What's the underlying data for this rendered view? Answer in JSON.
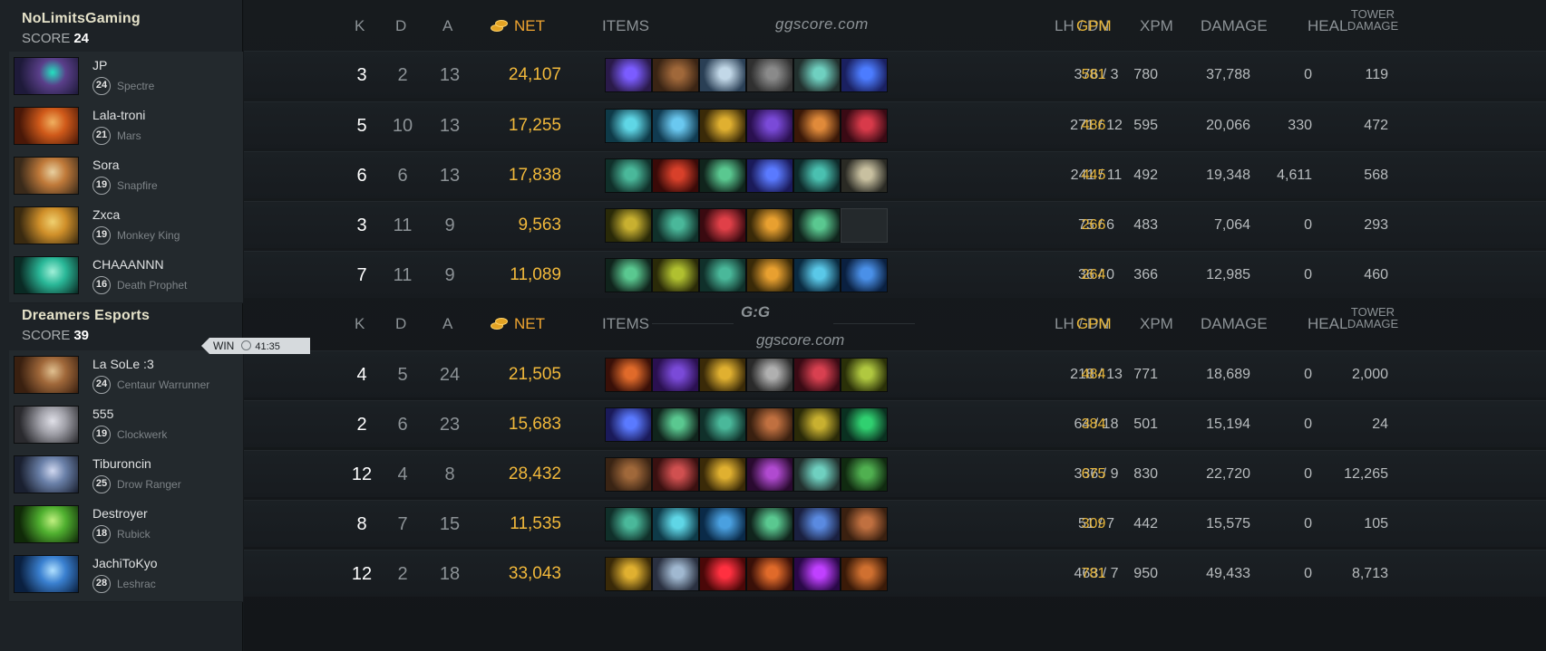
{
  "teams": [
    {
      "name": "NoLimitsGaming",
      "score_label": "SCORE",
      "score": "24",
      "players": [
        {
          "name": "JP",
          "level": "24",
          "hero": "Spectre",
          "portrait": [
            "#1e1a3a",
            "#5a3f8a",
            "#24e0c0"
          ],
          "k": "3",
          "d": "2",
          "a": "13",
          "net": "24,107",
          "lh": "376",
          "dn": "3",
          "gpm": "581",
          "xpm": "780",
          "damage": "37,788",
          "heal": "0",
          "tower": "119",
          "items": [
            [
              "#2a1a4a",
              "#7b5cff"
            ],
            [
              "#3a2414",
              "#a0683a"
            ],
            [
              "#2a3f55",
              "#c2d8e8"
            ],
            [
              "#303030",
              "#8a8a8a"
            ],
            [
              "#22302e",
              "#6fd0c0"
            ],
            [
              "#1a2060",
              "#4c7cff"
            ]
          ]
        },
        {
          "name": "Lala-troni",
          "level": "21",
          "hero": "Mars",
          "portrait": [
            "#4a1808",
            "#d05a1a",
            "#f0b060"
          ],
          "k": "5",
          "d": "10",
          "a": "13",
          "net": "17,255",
          "lh": "271",
          "dn": "12",
          "gpm": "486",
          "xpm": "595",
          "damage": "20,066",
          "heal": "330",
          "tower": "472",
          "items": [
            [
              "#0e3a48",
              "#5fd6e6"
            ],
            [
              "#103a50",
              "#6ac8f0"
            ],
            [
              "#3a2a08",
              "#e0b030"
            ],
            [
              "#2a1050",
              "#7a4ad8"
            ],
            [
              "#3a1808",
              "#e08a3a"
            ],
            [
              "#3a0a14",
              "#d83a4a"
            ]
          ]
        },
        {
          "name": "Sora",
          "level": "19",
          "hero": "Snapfire",
          "portrait": [
            "#3a2a1a",
            "#c07a3a",
            "#e8d0a0"
          ],
          "k": "6",
          "d": "6",
          "a": "13",
          "net": "17,838",
          "lh": "241",
          "dn": "11",
          "gpm": "445",
          "xpm": "492",
          "damage": "19,348",
          "heal": "4,611",
          "tower": "568",
          "items": [
            [
              "#10302a",
              "#4ab89a"
            ],
            [
              "#3a0a08",
              "#d8402a"
            ],
            [
              "#10241c",
              "#5ac890"
            ],
            [
              "#1a1a5a",
              "#5a7aff"
            ],
            [
              "#0e2a2a",
              "#4ac0b0"
            ],
            [
              "#2a2a24",
              "#c8c0a0"
            ]
          ]
        },
        {
          "name": "Zxca",
          "level": "19",
          "hero": "Monkey King",
          "portrait": [
            "#3a2a10",
            "#d0902a",
            "#f0d070"
          ],
          "k": "3",
          "d": "11",
          "a": "9",
          "net": "9,563",
          "lh": "75",
          "dn": "6",
          "gpm": "266",
          "xpm": "483",
          "damage": "7,064",
          "heal": "0",
          "tower": "293",
          "items": [
            [
              "#2a2a08",
              "#c8b030"
            ],
            [
              "#10302a",
              "#4ab89a"
            ],
            [
              "#3a0a10",
              "#e04048"
            ],
            [
              "#3a2a08",
              "#e8a030"
            ],
            [
              "#10241c",
              "#5ac890"
            ],
            [
              "#24292c",
              "#24292c"
            ]
          ]
        },
        {
          "name": "CHAAANNN",
          "level": "16",
          "hero": "Death Prophet",
          "portrait": [
            "#0a2a24",
            "#2ab898",
            "#a0f0d8"
          ],
          "k": "7",
          "d": "11",
          "a": "9",
          "net": "11,089",
          "lh": "36",
          "dn": "0",
          "gpm": "264",
          "xpm": "366",
          "damage": "12,985",
          "heal": "0",
          "tower": "460",
          "items": [
            [
              "#10241c",
              "#5ac890"
            ],
            [
              "#2a2a08",
              "#b0c030"
            ],
            [
              "#10302a",
              "#4ab89a"
            ],
            [
              "#3a2a08",
              "#e8a030"
            ],
            [
              "#0a2a40",
              "#5ac8e8"
            ],
            [
              "#0a2040",
              "#4a90e8"
            ]
          ]
        }
      ]
    },
    {
      "name": "Dreamers Esports",
      "score_label": "SCORE",
      "score": "39",
      "result": "WIN",
      "duration": "41:35",
      "players": [
        {
          "name": "La SoLe :3",
          "level": "24",
          "hero": "Centaur Warrunner",
          "portrait": [
            "#3a2010",
            "#a0683a",
            "#e0c090"
          ],
          "k": "4",
          "d": "5",
          "a": "24",
          "net": "21,505",
          "lh": "218",
          "dn": "13",
          "gpm": "484",
          "xpm": "771",
          "damage": "18,689",
          "heal": "0",
          "tower": "2,000",
          "items": [
            [
              "#3a1008",
              "#e06a2a"
            ],
            [
              "#2a1050",
              "#7a4ad8"
            ],
            [
              "#3a2a08",
              "#e0b030"
            ],
            [
              "#2a2a2a",
              "#b0b0b0"
            ],
            [
              "#3a0a14",
              "#d84050"
            ],
            [
              "#2a3008",
              "#b0c840"
            ]
          ]
        },
        {
          "name": "555",
          "level": "19",
          "hero": "Clockwerk",
          "portrait": [
            "#2a2a2e",
            "#a0a0a8",
            "#e0e0e8"
          ],
          "k": "2",
          "d": "6",
          "a": "23",
          "net": "15,683",
          "lh": "64",
          "dn": "18",
          "gpm": "384",
          "xpm": "501",
          "damage": "15,194",
          "heal": "0",
          "tower": "24",
          "items": [
            [
              "#1a1a5a",
              "#5a7aff"
            ],
            [
              "#10241c",
              "#5ac890"
            ],
            [
              "#10302a",
              "#4ab89a"
            ],
            [
              "#3a2010",
              "#c07040"
            ],
            [
              "#2a2a08",
              "#c8b030"
            ],
            [
              "#0a3020",
              "#30d070"
            ]
          ]
        },
        {
          "name": "Tiburoncin",
          "level": "25",
          "hero": "Drow Ranger",
          "portrait": [
            "#1a2030",
            "#6a80a8",
            "#d0d8f0"
          ],
          "k": "12",
          "d": "4",
          "a": "8",
          "net": "28,432",
          "lh": "336",
          "dn": "9",
          "gpm": "675",
          "xpm": "830",
          "damage": "22,720",
          "heal": "0",
          "tower": "12,265",
          "items": [
            [
              "#3a2414",
              "#a0683a"
            ],
            [
              "#3a1010",
              "#d05050"
            ],
            [
              "#3a2a08",
              "#e0b030"
            ],
            [
              "#2a0a30",
              "#b04ad0"
            ],
            [
              "#22302e",
              "#6fd0c0"
            ],
            [
              "#102a10",
              "#50b050"
            ]
          ]
        },
        {
          "name": "Destroyer",
          "level": "18",
          "hero": "Rubick",
          "portrait": [
            "#102a08",
            "#50b030",
            "#c0f080"
          ],
          "k": "8",
          "d": "7",
          "a": "15",
          "net": "11,535",
          "lh": "51",
          "dn": "7",
          "gpm": "309",
          "xpm": "442",
          "damage": "15,575",
          "heal": "0",
          "tower": "105",
          "items": [
            [
              "#10302a",
              "#4ab89a"
            ],
            [
              "#0e3a48",
              "#5fd6e6"
            ],
            [
              "#0a2a48",
              "#4aa0e0"
            ],
            [
              "#10241c",
              "#5ac890"
            ],
            [
              "#1a2040",
              "#5a8ae0"
            ],
            [
              "#3a2010",
              "#c07040"
            ]
          ]
        },
        {
          "name": "JachiToKyo",
          "level": "28",
          "hero": "Leshrac",
          "portrait": [
            "#0a2040",
            "#3a80d0",
            "#b0e0ff"
          ],
          "k": "12",
          "d": "2",
          "a": "18",
          "net": "33,043",
          "lh": "463",
          "dn": "7",
          "gpm": "781",
          "xpm": "950",
          "damage": "49,433",
          "heal": "0",
          "tower": "8,713",
          "items": [
            [
              "#3a2a08",
              "#e0b030"
            ],
            [
              "#2a3040",
              "#a0b8d0"
            ],
            [
              "#4a0808",
              "#ff3040"
            ],
            [
              "#3a1008",
              "#e06a2a"
            ],
            [
              "#2a0848",
              "#c040ff"
            ],
            [
              "#3a1a08",
              "#d07030"
            ]
          ]
        }
      ]
    }
  ],
  "columns": {
    "k": "K",
    "d": "D",
    "a": "A",
    "net": "NET",
    "items": "ITEMS",
    "lh_dn": "LH  /  DN",
    "gpm": "GPM",
    "xpm": "XPM",
    "damage": "DAMAGE",
    "heal": "HEAL",
    "tower": "TOWER\nDAMAGE"
  },
  "watermark": "ggscore.com",
  "logo": "G:G",
  "logo_sub": "ggscore.com",
  "icons": {
    "coin": "gold-coins-icon",
    "clock": "clock-icon"
  },
  "colors": {
    "gold": "#e8b63a",
    "net": "#f0a530",
    "team_name": "#e5e2c9"
  }
}
